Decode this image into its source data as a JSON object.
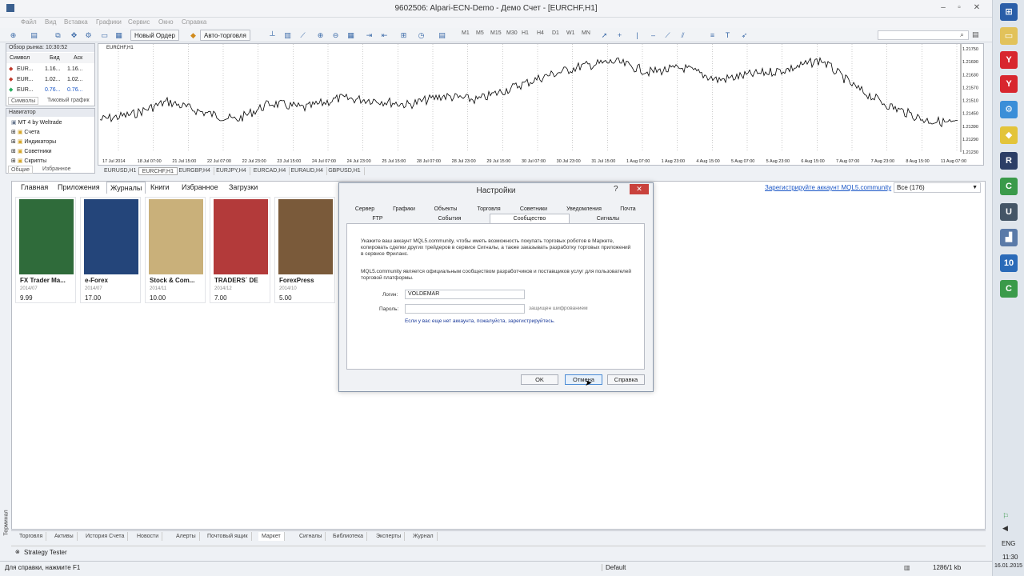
{
  "window": {
    "title": "9602506: Alpari-ECN-Demo - Демо Счет - [EURCHF,H1]"
  },
  "menu": [
    "Файл",
    "Вид",
    "Вставка",
    "Графики",
    "Сервис",
    "Окно",
    "Справка"
  ],
  "toolbar": {
    "new_order": "Новый Ордер",
    "autotrading": "Авто-торговля",
    "timeframes": [
      "M1",
      "M5",
      "M15",
      "M30",
      "H1",
      "H4",
      "D1",
      "W1",
      "MN"
    ]
  },
  "market_watch": {
    "title": "Обзор рынка: 10:30:52",
    "cols": [
      "Символ",
      "Бид",
      "Аск"
    ],
    "rows": [
      [
        "EUR...",
        "1.16...",
        "1.16..."
      ],
      [
        "EUR...",
        "1.02...",
        "1.02..."
      ],
      [
        "EUR...",
        "0.76...",
        "0.76..."
      ]
    ],
    "tabs": [
      "Символы",
      "Тиковый график"
    ]
  },
  "navigator": {
    "title": "Навигатор",
    "items": [
      "MT 4 by Weltrade",
      "Счета",
      "Индикаторы",
      "Советники",
      "Скрипты"
    ],
    "tabs": [
      "Общие",
      "Избранное"
    ]
  },
  "chart": {
    "label": "EURCHF,H1",
    "prices": [
      "1.21750",
      "1.21690",
      "1.21630",
      "1.21570",
      "1.21510",
      "1.21450",
      "1.21390",
      "1.21290",
      "1.21230"
    ],
    "dates": [
      "17 Jul 2014",
      "18 Jul 07:00",
      "21 Jul 15:00",
      "22 Jul 07:00",
      "22 Jul 23:00",
      "23 Jul 15:00",
      "24 Jul 07:00",
      "24 Jul 23:00",
      "25 Jul 15:00",
      "28 Jul 07:00",
      "28 Jul 23:00",
      "29 Jul 15:00",
      "30 Jul 07:00",
      "30 Jul 23:00",
      "31 Jul 15:00",
      "1 Aug 07:00",
      "1 Aug 23:00",
      "4 Aug 15:00",
      "5 Aug 07:00",
      "5 Aug 23:00",
      "6 Aug 15:00",
      "7 Aug 07:00",
      "7 Aug 23:00",
      "8 Aug 15:00",
      "11 Aug 07:00"
    ],
    "tabs": [
      "EURUSD,H1",
      "EURCHF,H1",
      "EURGBP,H4",
      "EURJPY,H4",
      "EURCAD,H4",
      "EURAUD,H4",
      "GBPUSD,H1"
    ]
  },
  "market": {
    "tabs": [
      "Главная",
      "Приложения",
      "Журналы",
      "Книги",
      "Избранное",
      "Загрузки"
    ],
    "register_link": "Зарегистрируйте аккаунт MQL5.community",
    "filter": "Все (176)",
    "items": [
      {
        "name": "FX Trader Ma...",
        "date": "2014/07",
        "price": "9.99",
        "color": "#2f6b3a"
      },
      {
        "name": "e-Forex",
        "date": "2014/07",
        "price": "17.00",
        "color": "#24457a"
      },
      {
        "name": "Stock & Com...",
        "date": "2014/11",
        "price": "10.00",
        "color": "#c9b07a"
      },
      {
        "name": "TRADERS´ DE",
        "date": "2014/12",
        "price": "7.00",
        "color": "#b33a3a"
      },
      {
        "name": "ForexPress",
        "date": "2014/10",
        "price": "5.00",
        "color": "#7a5a3a"
      }
    ]
  },
  "bottom_tabs": [
    "Торговля",
    "Активы",
    "История Счета",
    "Новости",
    "Алерты",
    "Почтовый ящик",
    "Маркет",
    "Сигналы",
    "Библиотека",
    "Эксперты",
    "Журнал"
  ],
  "side_label": "Терминал",
  "strategy_tester": "Strategy Tester",
  "status": {
    "help": "Для справки, нажмите F1",
    "profile": "Default",
    "traffic": "1286/1 kb"
  },
  "taskbar": {
    "lang": "ENG",
    "time": "11:30",
    "date": "16.01.2015"
  },
  "dialog": {
    "title": "Настройки",
    "help": "?",
    "tabs_row1": [
      "Сервер",
      "Графики",
      "Объекты",
      "Торговля",
      "Советники",
      "Уведомления",
      "Почта"
    ],
    "tabs_row2": [
      "FTP",
      "События",
      "Сообщество",
      "Сигналы"
    ],
    "text1": "Укажите ваш аккаунт MQL5.community, чтобы иметь возможность покупать торговых роботов в Маркете, копировать сделки других трейдеров в сервисе Сигналы, а также заказывать разработку торговых приложений в сервисе Фриланс.",
    "text2": "MQL5.community является официальным сообществом разработчиков и поставщиков услуг для пользователей торговой платформы.",
    "login_label": "Логин:",
    "login_value": "VOLDEMAR",
    "password_label": "Пароль:",
    "password_value": "",
    "protected": "защищен шифрованием",
    "register": "Если у вас еще нет аккаунта, пожалуйста, зарегистрируйтесь.",
    "ok": "OK",
    "cancel": "Отмена",
    "help_btn": "Справка"
  }
}
